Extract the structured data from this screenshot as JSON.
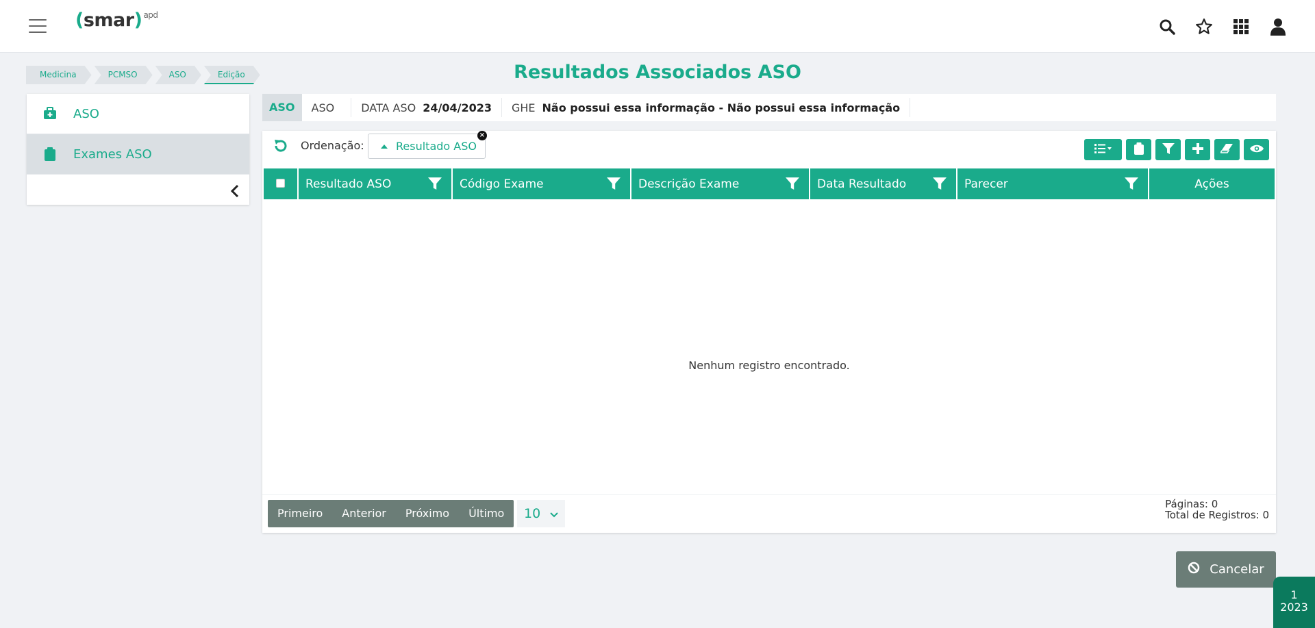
{
  "header": {
    "logo_main": "smar",
    "logo_open": "(",
    "logo_close": ")",
    "logo_sup": "apd",
    "icons": [
      "menu-icon",
      "search-icon",
      "star-icon",
      "apps-grid-icon",
      "user-icon"
    ]
  },
  "breadcrumb": [
    "Medicina",
    "PCMSO",
    "ASO",
    "Edição"
  ],
  "page_title": "Resultados Associados ASO",
  "sidebar": {
    "items": [
      {
        "label": "ASO",
        "icon": "medical-case-icon"
      },
      {
        "label": "Exames ASO",
        "icon": "clipboard-icon"
      }
    ]
  },
  "info": {
    "tag": "ASO",
    "aso_value": "ASO",
    "data_aso_label": "DATA ASO",
    "data_aso_value": "24/04/2023",
    "ghe_label": "GHE",
    "ghe_value": "Não possui essa informação - Não possui essa informação"
  },
  "grid": {
    "ordering_label": "Ordenação:",
    "sort_chip": "Resultado ASO",
    "sort_chip_close": "×",
    "columns": [
      "Resultado ASO",
      "Código Exame",
      "Descrição Exame",
      "Data Resultado",
      "Parecer",
      "Ações"
    ],
    "empty_message": "Nenhum registro encontrado.",
    "toolbar_icons": [
      "column-list-icon",
      "clipboard-icon",
      "filter-icon",
      "plus-icon",
      "eraser-icon",
      "eye-icon"
    ]
  },
  "pager": {
    "first": "Primeiro",
    "prev": "Anterior",
    "next": "Próximo",
    "last": "Último",
    "page_size": "10",
    "pages": "Páginas: 0",
    "total": "Total de Registros: 0"
  },
  "actions": {
    "cancel": "Cancelar"
  },
  "badge": {
    "line1": "1",
    "line2": "2023"
  },
  "colors": {
    "accent": "#1aab8b",
    "pager_bg": "#6b7d77",
    "badge_bg": "#0b7a5d"
  }
}
